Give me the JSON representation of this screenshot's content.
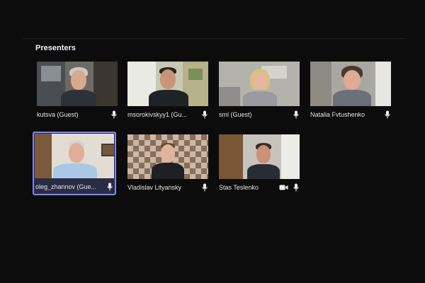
{
  "section": {
    "title": "Presenters"
  },
  "participants": [
    {
      "name": "kutsva (Guest)",
      "mic": "mic-icon"
    },
    {
      "name": "msorokivskyy1 (Gu...",
      "mic": "mic-icon"
    },
    {
      "name": "sml (Guest)",
      "mic": "mic-icon"
    },
    {
      "name": "Natalia Fvtushenko",
      "mic": "mic-icon"
    },
    {
      "name": "oleg_zhannov (Gue...",
      "mic": "mic-icon",
      "active": true
    },
    {
      "name": "Vladislav Lityansky",
      "mic": "mic-icon"
    },
    {
      "name": "Stas Teslenko",
      "mic": "mic-icon",
      "camera": "video-camera-icon"
    }
  ],
  "colors": {
    "background": "#0c0c0c",
    "active_border": "#7f85f5",
    "active_bg": "#2a2b45"
  }
}
